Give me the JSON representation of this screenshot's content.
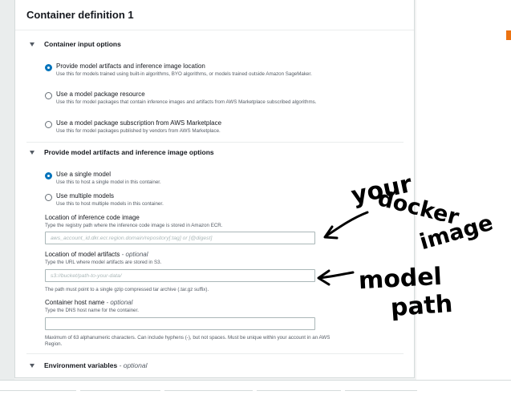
{
  "panel": {
    "title": "Container definition 1"
  },
  "container_input_options": {
    "title": "Container input options",
    "options": [
      {
        "label": "Provide model artifacts and inference image location",
        "desc": "Use this for models trained using built-in algorithms, BYO algorithms, or models trained outside Amazon SageMaker.",
        "selected": true
      },
      {
        "label": "Use a model package resource",
        "desc": "Use this for model packages that contain inference images and artifacts from AWS Marketplace subscribed algorithms.",
        "selected": false
      },
      {
        "label": "Use a model package subscription from AWS Marketplace",
        "desc": "Use this for model packages published by vendors from AWS Marketplace.",
        "selected": false
      }
    ]
  },
  "artifacts_section": {
    "title": "Provide model artifacts and inference image options",
    "options": [
      {
        "label": "Use a single model",
        "desc": "Use this to host a single model in this container.",
        "selected": true
      },
      {
        "label": "Use multiple models",
        "desc": "Use this to host multiple models in this container.",
        "selected": false
      }
    ],
    "image_field": {
      "label": "Location of inference code image",
      "desc": "Type the registry path where the inference code image is stored in Amazon ECR.",
      "placeholder": "aws_account_id.dkr.ecr.region.domain/repository[:tag] or [@digest]",
      "value": ""
    },
    "artifacts_field": {
      "label": "Location of model artifacts",
      "optional": " - optional",
      "desc": "Type the URL where model artifacts are stored in S3.",
      "placeholder": "s3://bucket/path-to-your-data/",
      "value": "",
      "hint": "The path must point to a single gzip compressed tar archive (.tar.gz suffix)."
    },
    "host_field": {
      "label": "Container host name",
      "optional": " - optional",
      "desc": "Type the DNS host name for the container.",
      "value": "",
      "hint": "Maximum of 63 alphanumeric characters. Can include hyphens (-), but not spaces. Must be unique within your account in an AWS Region."
    }
  },
  "environment_variables": {
    "title": "Environment variables",
    "optional": " - optional"
  },
  "annotations": {
    "docker": [
      "your",
      "docker",
      "image"
    ],
    "model": [
      "model",
      "path"
    ]
  },
  "colors": {
    "accent": "#0073bb",
    "arrow": "#000000"
  }
}
